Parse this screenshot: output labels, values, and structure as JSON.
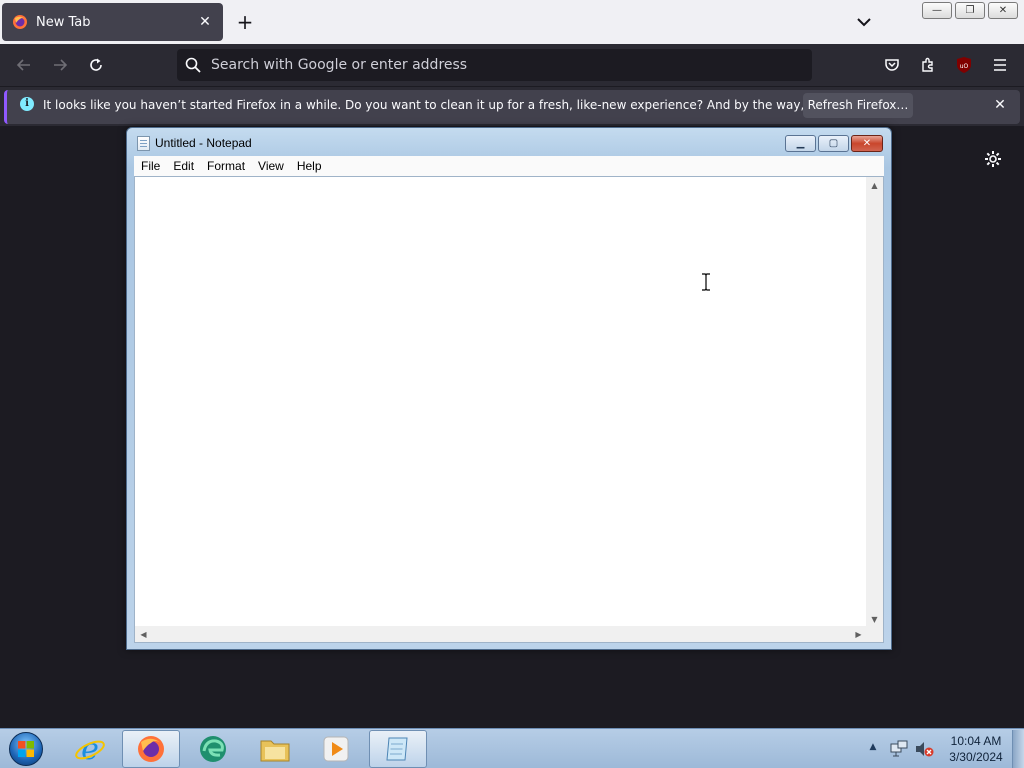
{
  "browser": {
    "tab": {
      "title": "New Tab",
      "close_glyph": "✕"
    },
    "new_tab_glyph": "+",
    "window_controls": {
      "minimize": "—",
      "restore": "❐",
      "close": "✕"
    },
    "urlbar": {
      "placeholder": "Search with Google or enter address",
      "value": ""
    },
    "toolbar_icons": [
      "back-icon",
      "forward-icon",
      "reload-icon",
      "pocket-icon",
      "extensions-icon",
      "ublock-icon",
      "menu-icon"
    ],
    "notification": {
      "info_glyph": "i",
      "message": "It looks like you haven’t started Firefox in a while. Do you want to clean it up for a fresh, like-new experience? And by the way, welcome back!",
      "button_label": "Refresh Firefox…",
      "close_glyph": "✕"
    },
    "colors": {
      "toolbar": "#2b2a33",
      "content": "#1c1b22",
      "tab_active": "#42414d",
      "accent": "#9059ff"
    }
  },
  "notepad": {
    "title": "Untitled - Notepad",
    "menu": [
      "File",
      "Edit",
      "Format",
      "View",
      "Help"
    ],
    "content": "",
    "controls": {
      "minimize": "▁",
      "maximize": "▢",
      "close": "✕"
    }
  },
  "taskbar": {
    "items": [
      "start-orb",
      "internet-explorer",
      "firefox",
      "edge",
      "file-explorer",
      "media-player",
      "notepad"
    ],
    "active": [
      "firefox",
      "notepad"
    ],
    "tray_arrow": "▲",
    "clock": {
      "time": "10:04 AM",
      "date": "3/30/2024"
    }
  }
}
